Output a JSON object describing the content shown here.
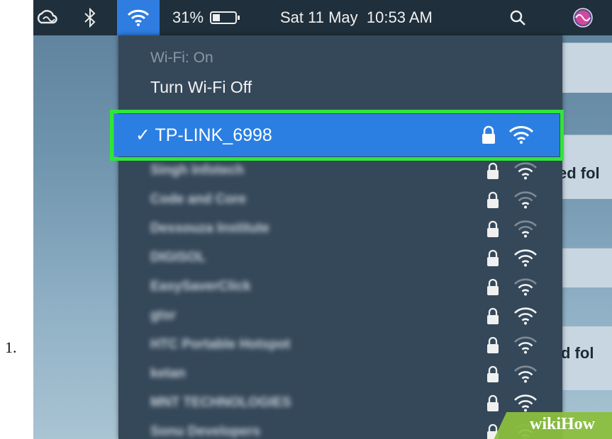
{
  "step": {
    "number": "1."
  },
  "menubar": {
    "battery_percent": "31%",
    "datetime": "Sat 11 May  10:53 AM"
  },
  "background_window": {
    "text_1": "ed fol",
    "text_2": "d fol"
  },
  "wifi_menu": {
    "status": "Wi-Fi: On",
    "toggle_label": "Turn Wi-Fi Off",
    "connected_network": "✓ TP-LINK_6998",
    "networks": [
      {
        "name": "Singh Infotech",
        "locked": true,
        "signal": 2
      },
      {
        "name": "Code and Core",
        "locked": true,
        "signal": 1
      },
      {
        "name": "Dessouza Institute",
        "locked": true,
        "signal": 1
      },
      {
        "name": "DIGISOL",
        "locked": true,
        "signal": 3
      },
      {
        "name": "EasySaverClick",
        "locked": true,
        "signal": 2
      },
      {
        "name": "gtsr",
        "locked": true,
        "signal": 3
      },
      {
        "name": "HTC Portable Hotspot",
        "locked": true,
        "signal": 2
      },
      {
        "name": "ketan",
        "locked": true,
        "signal": 2
      },
      {
        "name": "MNT TECHNOLOGIES",
        "locked": true,
        "signal": 3
      },
      {
        "name": "Sonu Developers",
        "locked": true,
        "signal": 2
      }
    ]
  },
  "watermark": {
    "text": "wikiHow"
  },
  "colors": {
    "highlight_border": "#2ee63a",
    "selected_row": "#2b7fe2",
    "menu_background": "#35485a",
    "menubar_background": "#1f2f3b"
  }
}
